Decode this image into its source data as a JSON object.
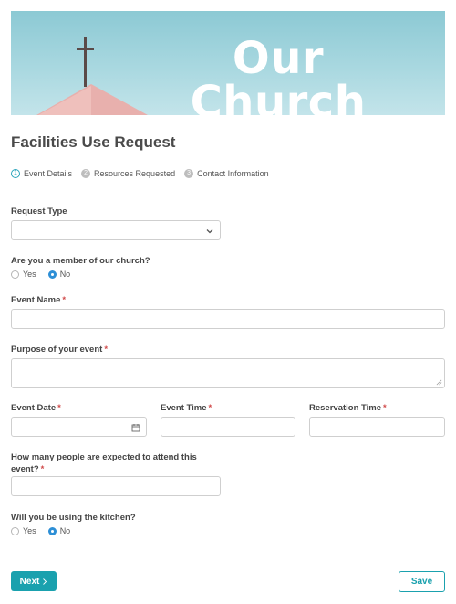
{
  "banner": {
    "title": "Our Church"
  },
  "form": {
    "title": "Facilities Use Request"
  },
  "steps": [
    {
      "num": "1",
      "label": "Event Details"
    },
    {
      "num": "2",
      "label": "Resources Requested"
    },
    {
      "num": "3",
      "label": "Contact Information"
    }
  ],
  "fields": {
    "request_type": {
      "label": "Request Type",
      "value": ""
    },
    "member": {
      "label": "Are you a member of our church?",
      "options": [
        "Yes",
        "No"
      ],
      "selected": "No"
    },
    "event_name": {
      "label": "Event Name",
      "required": "*",
      "value": ""
    },
    "purpose": {
      "label": "Purpose of your event",
      "required": "*",
      "value": ""
    },
    "event_date": {
      "label": "Event Date",
      "required": "*",
      "value": ""
    },
    "event_time": {
      "label": "Event Time",
      "required": "*",
      "value": ""
    },
    "reservation_time": {
      "label": "Reservation Time",
      "required": "*",
      "value": ""
    },
    "attendance": {
      "label_line1": "How many people are expected to attend this",
      "label_line2": "event?",
      "required": "*",
      "value": ""
    },
    "kitchen": {
      "label": "Will you be using the kitchen?",
      "options": [
        "Yes",
        "No"
      ],
      "selected": "No"
    }
  },
  "buttons": {
    "next": "Next",
    "save": "Save"
  },
  "colors": {
    "accent": "#1aa1ae",
    "required": "#d14b4b",
    "radio_checked": "#2d8fd6",
    "banner_sky": "#a9d8e0"
  },
  "icons": {
    "dropdown": "chevron-down-icon",
    "date": "calendar-icon",
    "next": "chevron-right-icon"
  }
}
